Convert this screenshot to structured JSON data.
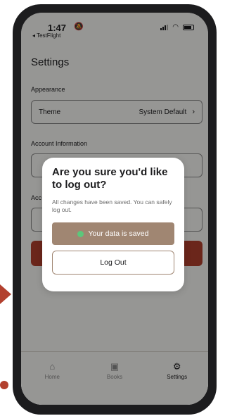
{
  "status_bar": {
    "time": "1:47",
    "bell_glyph": "🔕",
    "back_label": "◂ TestFlight"
  },
  "page": {
    "title": "Settings",
    "appearance_label": "Appearance",
    "theme_label": "Theme",
    "theme_value": "System Default",
    "account_information_label": "Account Information",
    "account_partial_label": "Acc"
  },
  "tabs": [
    {
      "label": "Home",
      "icon": "home-icon",
      "glyph": "⌂"
    },
    {
      "label": "Books",
      "icon": "books-icon",
      "glyph": "▣"
    },
    {
      "label": "Settings",
      "icon": "gear-icon",
      "glyph": "⚙"
    }
  ],
  "dialog": {
    "title": "Are you sure you'd like to log out?",
    "message": "All changes have been saved. You can safely log out.",
    "saved_label": "Your data is saved",
    "logout_label": "Log Out"
  },
  "colors": {
    "accent_red": "#b2402e",
    "saved_pill": "#a08672",
    "saved_dot": "#5cc77b"
  }
}
